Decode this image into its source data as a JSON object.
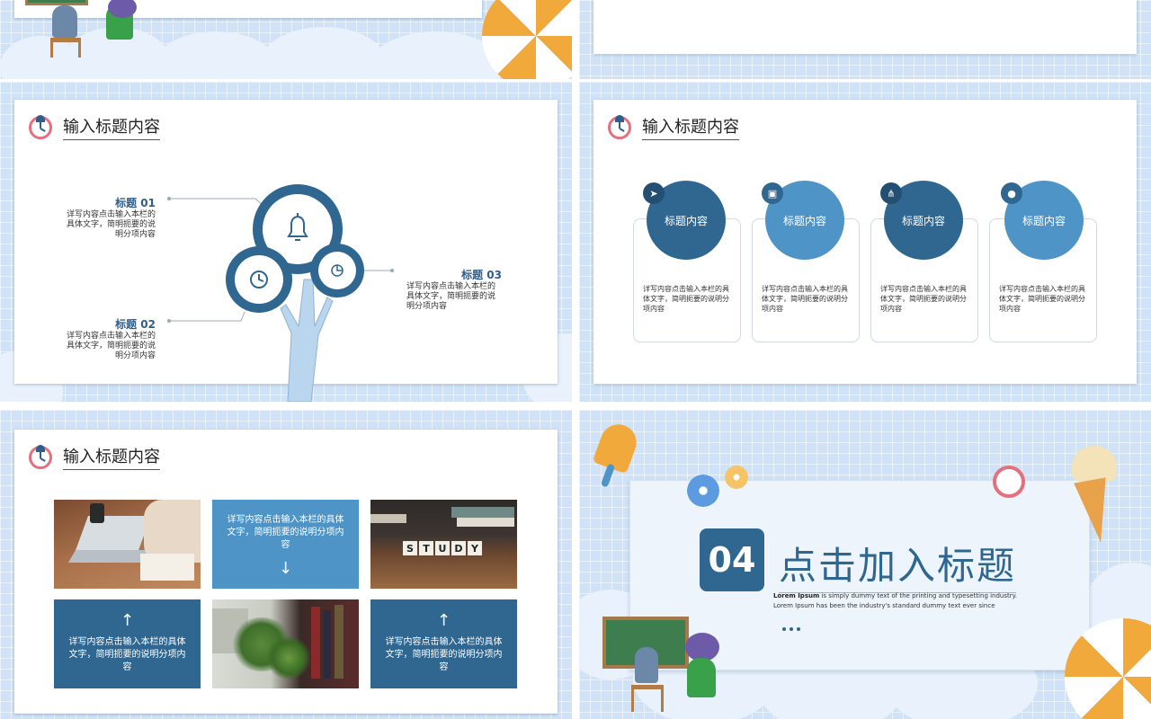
{
  "slide_a": {},
  "slide_b": {},
  "slide_tree": {
    "header": "输入标题内容",
    "items": [
      {
        "title": "标题 01",
        "desc": "详写内容点击输入本栏的具体文字，简明扼要的说明分项内容"
      },
      {
        "title": "标题 02",
        "desc": "详写内容点击输入本栏的具体文字，简明扼要的说明分项内容"
      },
      {
        "title": "标题 03",
        "desc": "详写内容点击输入本栏的具体文字，简明扼要的说明分项内容"
      }
    ]
  },
  "slide_cards": {
    "header": "输入标题内容",
    "cards": [
      {
        "label": "标题内容",
        "icon": "send-icon",
        "desc": "详写内容点击输入本栏的具体文字，简明扼要的说明分项内容"
      },
      {
        "label": "标题内容",
        "icon": "image-icon",
        "desc": "详写内容点击输入本栏的具体文字，简明扼要的说明分项内容"
      },
      {
        "label": "标题内容",
        "icon": "sitemap-icon",
        "desc": "详写内容点击输入本栏的具体文字，简明扼要的说明分项内容"
      },
      {
        "label": "标题内容",
        "icon": "user-icon",
        "desc": "详写内容点击输入本栏的具体文字，简明扼要的说明分项内容"
      }
    ]
  },
  "slide_grid": {
    "header": "输入标题内容",
    "cell1": "详写内容点击输入本栏的具体文字，简明扼要的说明分项内容",
    "cell2": "详写内容点击输入本栏的具体文字，简明扼要的说明分项内容",
    "cell3": "详写内容点击输入本栏的具体文字，简明扼要的说明分项内容",
    "study_letters": [
      "S",
      "T",
      "U",
      "D",
      "Y"
    ]
  },
  "slide_section": {
    "number": "04",
    "title": "点击加入标题",
    "lorem_bold": "Lorem Ipsum",
    "lorem_line1": " is simply dummy text of the printing and typesetting industry.",
    "lorem_line2": "Lorem Ipsum has been the industry's standard dummy text ever since"
  },
  "colors": {
    "dark_blue": "#2f6791",
    "mid_blue": "#4f94c7",
    "accent_orange": "#f2a93b",
    "clock_pink": "#e46f7e"
  }
}
